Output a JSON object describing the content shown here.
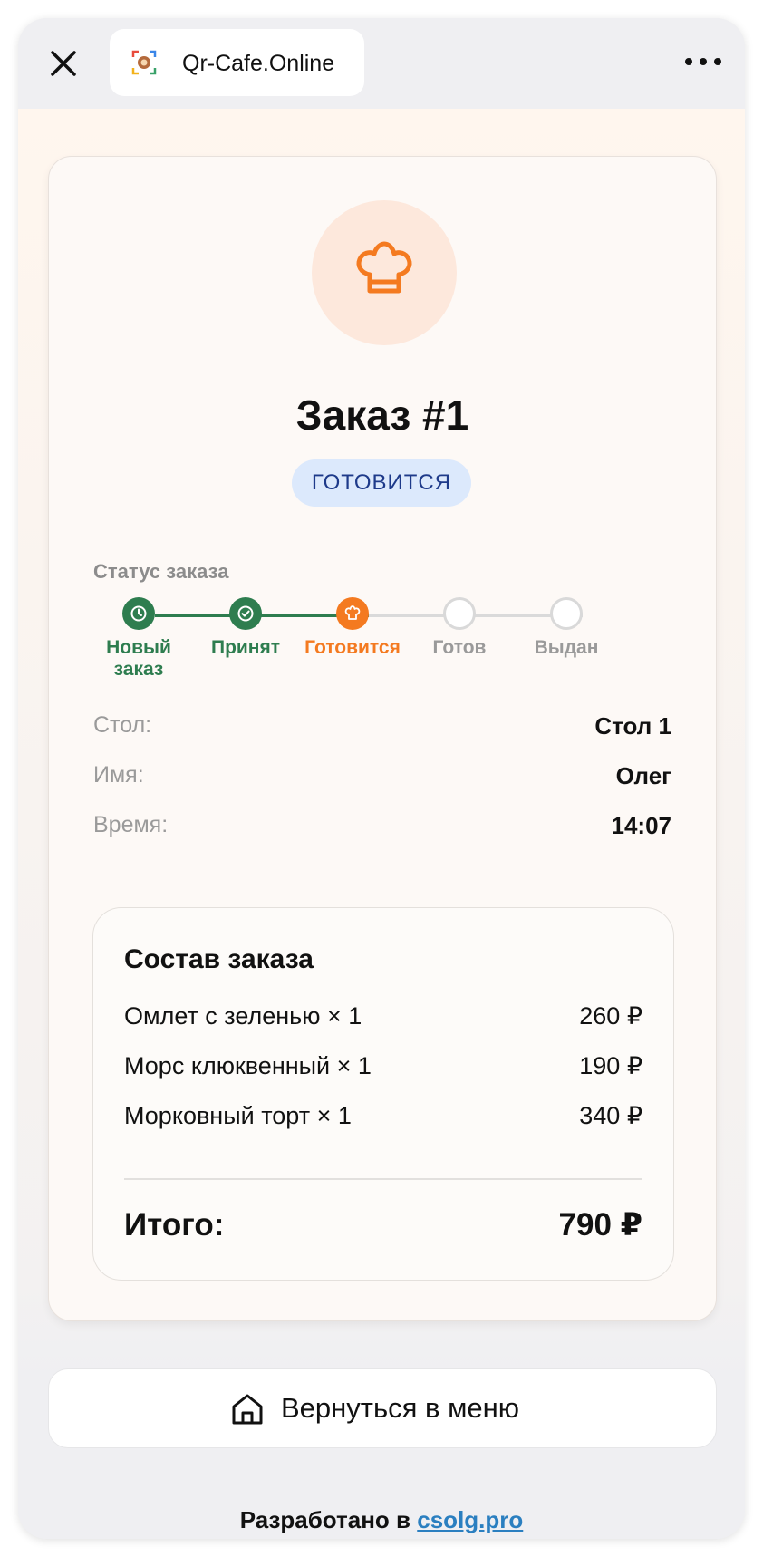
{
  "browser": {
    "site_title": "Qr-Cafe.Online",
    "close_icon": "close-icon",
    "more_icon": "more-horizontal-icon"
  },
  "order": {
    "hero_icon": "chef-hat-icon",
    "title": "Заказ #1",
    "status_badge": "ГОТОВИТСЯ",
    "status_heading": "Статус заказа",
    "steps": [
      {
        "label": "Новый заказ",
        "state": "done",
        "icon": "clock-icon"
      },
      {
        "label": "Принят",
        "state": "done",
        "icon": "check-circle-icon"
      },
      {
        "label": "Готовится",
        "state": "current",
        "icon": "chef-hat-icon"
      },
      {
        "label": "Готов",
        "state": "pending"
      },
      {
        "label": "Выдан",
        "state": "pending"
      }
    ],
    "info": [
      {
        "label": "Стол:",
        "value": "Стол 1"
      },
      {
        "label": "Имя:",
        "value": "Олег"
      },
      {
        "label": "Время:",
        "value": "14:07"
      }
    ]
  },
  "items": {
    "title": "Состав заказа",
    "list": [
      {
        "name": "Омлет с зеленью × 1",
        "price": "260 ₽"
      },
      {
        "name": "Морс клюквенный × 1",
        "price": "190 ₽"
      },
      {
        "name": "Морковный торт × 1",
        "price": "340 ₽"
      }
    ],
    "total_label": "Итого:",
    "total_value": "790 ₽"
  },
  "back_button": {
    "label": "Вернуться в меню",
    "icon": "home-icon"
  },
  "footer": {
    "prefix": "Разработано в",
    "link": "csolg.pro"
  },
  "colors": {
    "done": "#2e7d4f",
    "current": "#f47a20",
    "pending": "#d9d9d9",
    "badge_bg": "#dce9fc",
    "badge_text": "#1e3a8a",
    "link": "#2b7fc0"
  }
}
